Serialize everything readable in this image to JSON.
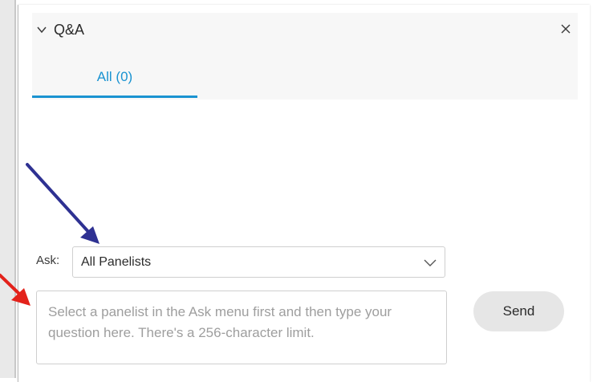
{
  "panel": {
    "title": "Q&A",
    "collapse_icon": "chevron-down-icon",
    "close_icon": "close-icon"
  },
  "tabs": [
    {
      "label": "All (0)",
      "active": true
    }
  ],
  "ask": {
    "label": "Ask:",
    "selected": "All Panelists"
  },
  "question": {
    "placeholder": "Select a panelist in the Ask menu first and then type your question here. There's a 256-character limit.",
    "value": ""
  },
  "send": {
    "label": "Send"
  },
  "colors": {
    "accent": "#1a93d1",
    "annotation_blue": "#2e3192",
    "annotation_red": "#e3221b"
  }
}
